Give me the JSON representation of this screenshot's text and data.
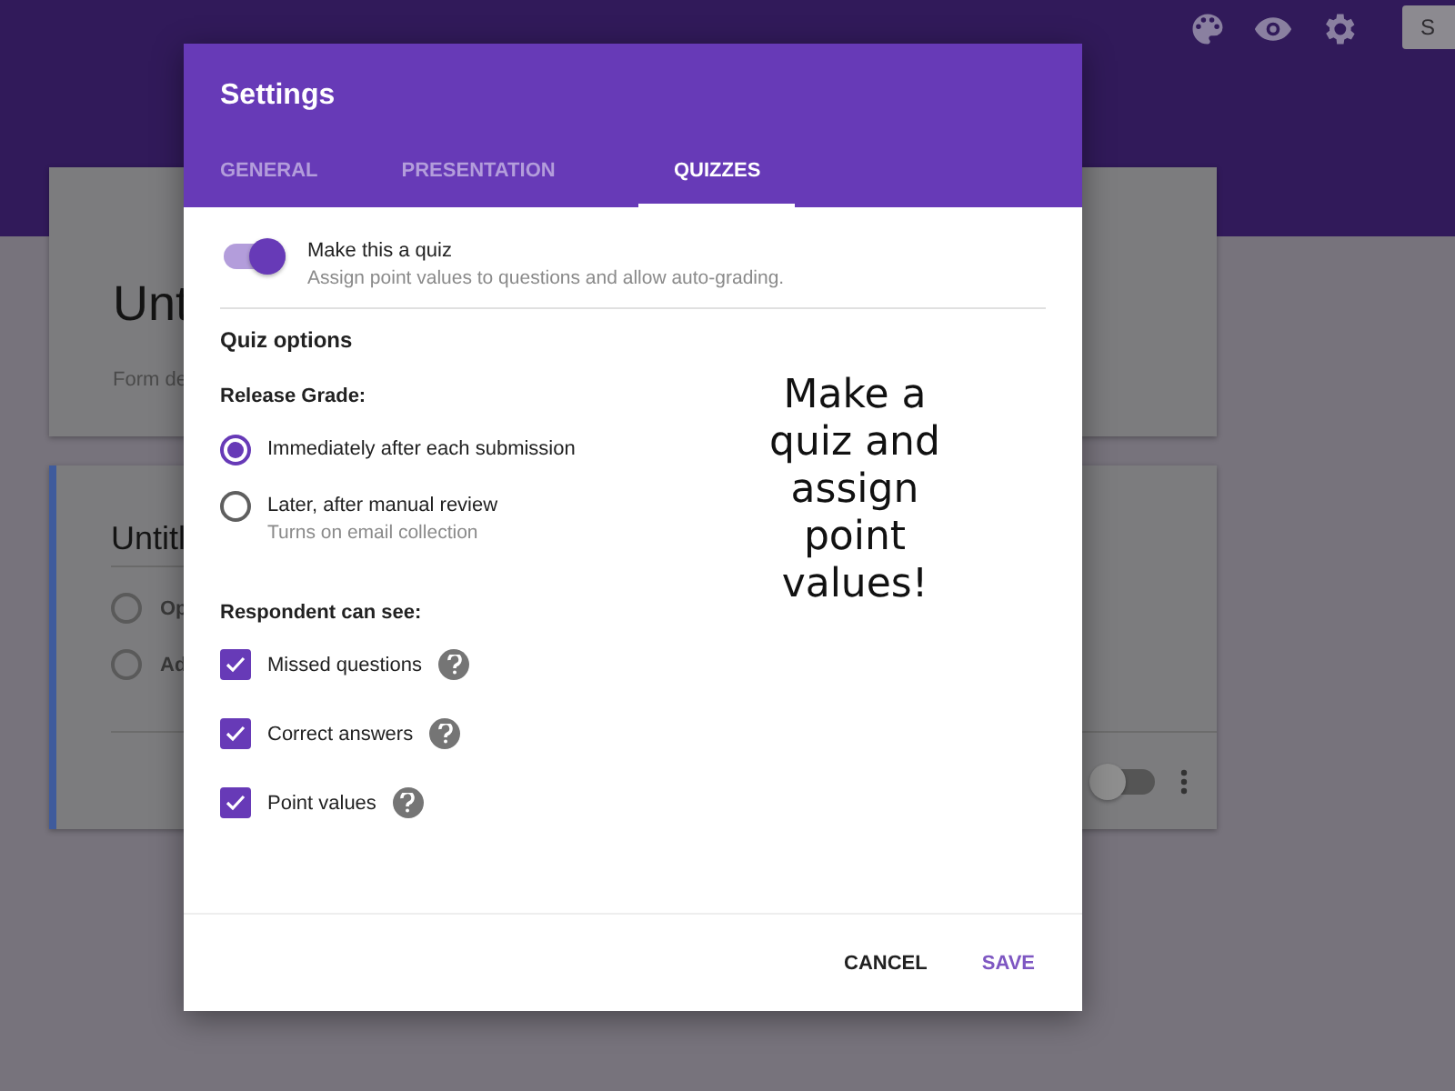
{
  "top_bar": {
    "send_button": "S"
  },
  "form": {
    "title": "Unt",
    "description": "Form de",
    "question": {
      "title": "Untitl",
      "options": [
        {
          "label": "Op"
        },
        {
          "label": "Ad"
        }
      ],
      "required": false
    }
  },
  "dialog": {
    "title": "Settings",
    "tabs": [
      {
        "label": "GENERAL",
        "selected": false
      },
      {
        "label": "PRESENTATION",
        "selected": false
      },
      {
        "label": "QUIZZES",
        "selected": true
      }
    ],
    "quiz_toggle": {
      "label": "Make this a quiz",
      "description": "Assign point values to questions and allow auto-grading.",
      "on": true
    },
    "section_title": "Quiz options",
    "release_grade": {
      "label": "Release Grade:",
      "options": [
        {
          "label": "Immediately after each submission",
          "selected": true
        },
        {
          "label": "Later, after manual review",
          "hint": "Turns on email collection",
          "selected": false
        }
      ]
    },
    "respondent": {
      "label": "Respondent can see:",
      "items": [
        {
          "label": "Missed questions",
          "checked": true
        },
        {
          "label": "Correct answers",
          "checked": true
        },
        {
          "label": "Point values",
          "checked": true
        }
      ]
    },
    "buttons": [
      {
        "label": "CANCEL",
        "kind": "secondary"
      },
      {
        "label": "SAVE",
        "kind": "primary"
      }
    ]
  },
  "annotation": "Make a quiz and assign point values!"
}
